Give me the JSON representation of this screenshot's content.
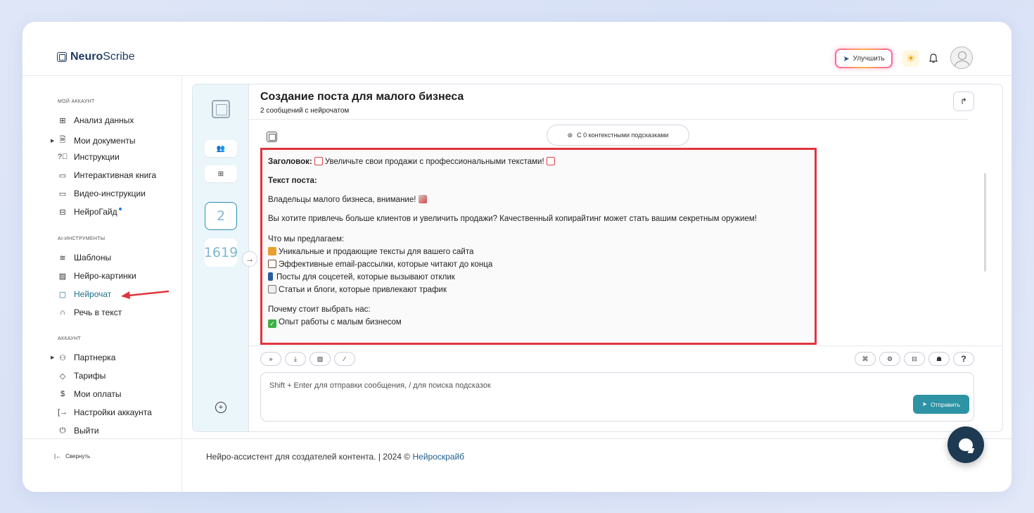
{
  "app": {
    "logo_bold": "Neuro",
    "logo_rest": "Scribe",
    "upgrade_label": "Улучшить"
  },
  "sidebar": {
    "section_account": "МОЙ АККАУНТ",
    "account_items": [
      {
        "label": "Анализ данных",
        "icon": "grid-icon"
      },
      {
        "label": "Мои документы",
        "icon": "document-icon"
      },
      {
        "label": "Инструкции",
        "icon": "help-icon"
      },
      {
        "label": "Интерактивная книга",
        "icon": "book-icon"
      },
      {
        "label": "Видео-инструкции",
        "icon": "video-icon"
      },
      {
        "label": "НейроГайд",
        "icon": "table-icon"
      }
    ],
    "section_tools": "AI-ИНСТРУМЕНТЫ",
    "tools_items": [
      {
        "label": "Шаблоны",
        "icon": "layers-icon"
      },
      {
        "label": "Нейро-картинки",
        "icon": "image-icon"
      },
      {
        "label": "Нейрочат",
        "icon": "chat-icon"
      },
      {
        "label": "Речь в текст",
        "icon": "headphones-icon"
      }
    ],
    "section_acc": "АККАУНТ",
    "acc_items": [
      {
        "label": "Партнерка",
        "icon": "users-icon"
      },
      {
        "label": "Тарифы",
        "icon": "tag-icon"
      },
      {
        "label": "Мои оплаты",
        "icon": "dollar-icon"
      },
      {
        "label": "Настройки аккаунта",
        "icon": "settings-exit-icon"
      },
      {
        "label": "Выйти",
        "icon": "power-icon"
      }
    ],
    "collapse_label": "Свернуть"
  },
  "rail": {
    "count_messages": "2",
    "count_tokens": "1619"
  },
  "chat": {
    "title": "Создание поста для малого бизнеса",
    "subtitle": "2 сообщений с нейрочатом",
    "context_pill": "С 0 контекстными подсказками",
    "message": {
      "headline_label": "Заголовок:",
      "headline_text": "Увеличьте свои продажи с профессиональными текстами!",
      "post_label": "Текст поста:",
      "p1": "Владельцы малого бизнеса, внимание!",
      "p2": "Вы хотите привлечь больше клиентов и увеличить продажи? Качественный копирайтинг может стать вашим секретным оружием!",
      "offer_title": "Что мы предлагаем:",
      "offers": [
        "Уникальные и продающие тексты для вашего сайта",
        "Эффективные email-рассылки, которые читают до конца",
        "Посты для соцсетей, которые вызывают отклик",
        "Статьи и блоги, которые привлекают трафик"
      ],
      "why_title": "Почему стоит выбрать нас:",
      "why_items": [
        "Опыт работы с малым бизнесом"
      ]
    },
    "input_placeholder": "Shift + Enter для отправки сообщения, / для поиска подсказок",
    "send_label": "Отправить",
    "help_label": "?"
  },
  "footer": {
    "text": "Нейро-ассистент для создателей контента.  | 2024 © ",
    "link": "Нейроскрайб"
  },
  "colors": {
    "accent": "#2d93a5",
    "highlight_border": "#e0353d",
    "rail_bg": "#ebf6fb",
    "fab": "#1e3a52"
  }
}
